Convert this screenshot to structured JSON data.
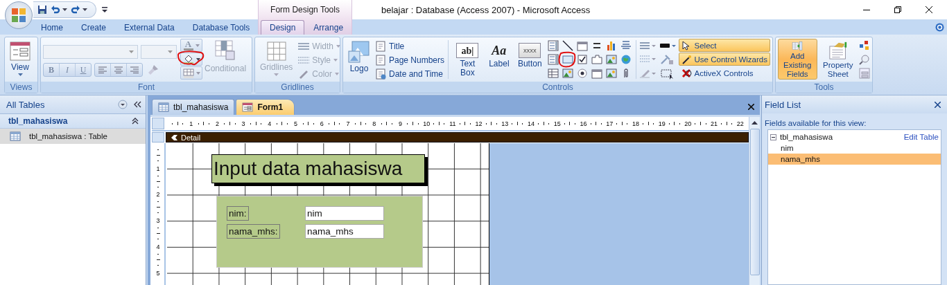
{
  "window": {
    "title": "belajar : Database (Access 2007) - Microsoft Access",
    "context_header": "Form Design Tools"
  },
  "tabs": [
    {
      "label": "Home",
      "selected": false,
      "contextual": false
    },
    {
      "label": "Create",
      "selected": false,
      "contextual": false
    },
    {
      "label": "External Data",
      "selected": false,
      "contextual": false
    },
    {
      "label": "Database Tools",
      "selected": false,
      "contextual": false
    },
    {
      "label": "Design",
      "selected": true,
      "contextual": true
    },
    {
      "label": "Arrange",
      "selected": false,
      "contextual": true
    }
  ],
  "ribbon": {
    "views": {
      "label": "Views",
      "view_button": "View"
    },
    "font": {
      "label": "Font",
      "disabled": true,
      "bold": "B",
      "italic": "I",
      "underline": "U",
      "font_color": "A",
      "conditional": "Conditional"
    },
    "gridlines": {
      "label": "Gridlines",
      "disabled": true,
      "button": "Gridlines",
      "options": [
        "Width",
        "Style",
        "Color"
      ]
    },
    "controls": {
      "label": "Controls",
      "logo": "Logo",
      "header_items": [
        "Title",
        "Page Numbers",
        "Date and Time"
      ],
      "big_tools": [
        {
          "label": "Text Box",
          "glyph": "ab|"
        },
        {
          "label": "Label",
          "glyph": "Aa"
        },
        {
          "label": "Button",
          "glyph": "XXXX"
        }
      ],
      "mode_buttons": [
        {
          "label": "Select",
          "on": true
        },
        {
          "label": "Use Control Wizards",
          "on": true
        },
        {
          "label": "ActiveX Controls",
          "on": false
        }
      ]
    },
    "tools": {
      "label": "Tools",
      "buttons": [
        {
          "label": "Add Existing Fields",
          "on": true
        },
        {
          "label": "Property Sheet",
          "on": false
        }
      ]
    }
  },
  "nav_pane": {
    "title": "All Tables",
    "groups": [
      {
        "name": "tbl_mahasiswa",
        "expanded": true,
        "items": [
          {
            "label": "tbl_mahasiswa : Table",
            "selected": true
          }
        ]
      }
    ]
  },
  "documents": {
    "tabs": [
      {
        "label": "tbl_mahasiswa",
        "selected": false,
        "kind": "table"
      },
      {
        "label": "Form1",
        "selected": true,
        "kind": "form"
      }
    ],
    "ruler": [
      "1",
      "2",
      "3",
      "4",
      "5",
      "6",
      "7",
      "8",
      "9",
      "10",
      "11",
      "12",
      "13",
      "14",
      "15",
      "16",
      "17",
      "18",
      "19",
      "20",
      "21",
      "22"
    ],
    "vertical_ruler": [
      "1",
      "2",
      "3",
      "4",
      "5"
    ],
    "section": "Detail",
    "form": {
      "title": "Input data mahasiswa",
      "fields": [
        {
          "label": "nim:",
          "value": "nim"
        },
        {
          "label": "nama_mhs:",
          "value": "nama_mhs"
        }
      ]
    }
  },
  "field_list": {
    "title": "Field List",
    "subtitle": "Fields available for this view:",
    "tables": [
      {
        "name": "tbl_mahasiswa",
        "expanded": true,
        "action": "Edit Table",
        "fields": [
          {
            "name": "nim",
            "selected": false
          },
          {
            "name": "nama_mhs",
            "selected": true
          }
        ]
      }
    ]
  }
}
